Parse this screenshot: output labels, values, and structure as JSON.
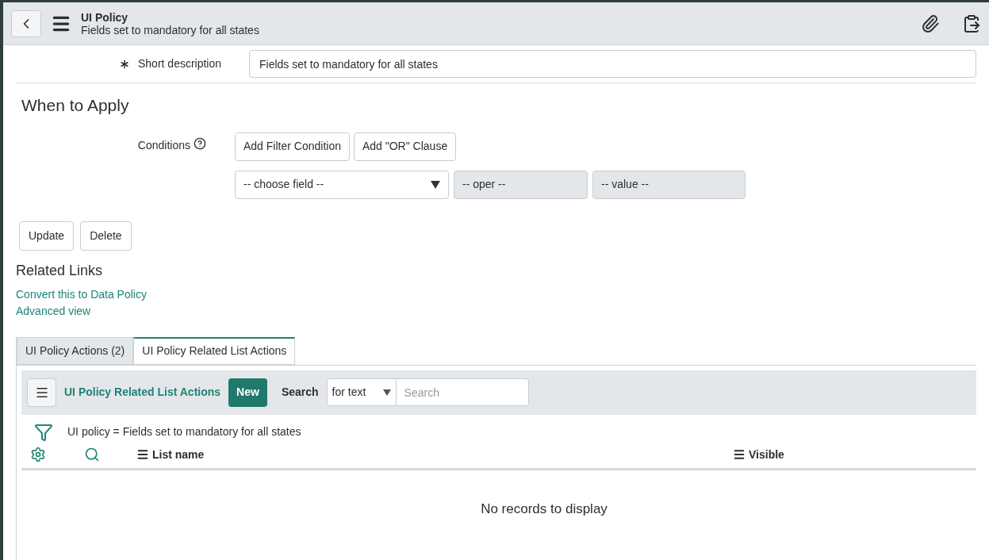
{
  "header": {
    "title": "UI Policy",
    "subtitle": "Fields set to mandatory for all states"
  },
  "short_description": {
    "label": "Short description",
    "value": "Fields set to mandatory for all states",
    "mandatory": true
  },
  "section_title": "When to Apply",
  "conditions": {
    "label": "Conditions",
    "buttons": [
      "Add Filter Condition",
      "Add \"OR\" Clause"
    ],
    "field": {
      "value": "-- choose field --"
    },
    "oper": {
      "value": "-- oper --",
      "disabled": true
    },
    "cond_value": {
      "value": "-- value --",
      "disabled": true
    }
  },
  "form_buttons": [
    "Update",
    "Delete"
  ],
  "related_links": {
    "title": "Related Links",
    "links": [
      "Convert this to Data Policy",
      "Advanced view"
    ]
  },
  "tabs": [
    {
      "label": "UI Policy Actions (2)",
      "selected": false
    },
    {
      "label": "UI Policy Related List Actions",
      "selected": true
    }
  ],
  "list": {
    "title": "UI Policy Related List Actions",
    "new_button": "New",
    "search_label": "Search",
    "search_mode": "for text",
    "search_placeholder": "Search",
    "filter": "UI policy = Fields set to mandatory for all states",
    "columns": [
      "List name",
      "Visible"
    ],
    "empty_message": "No records to display"
  }
}
